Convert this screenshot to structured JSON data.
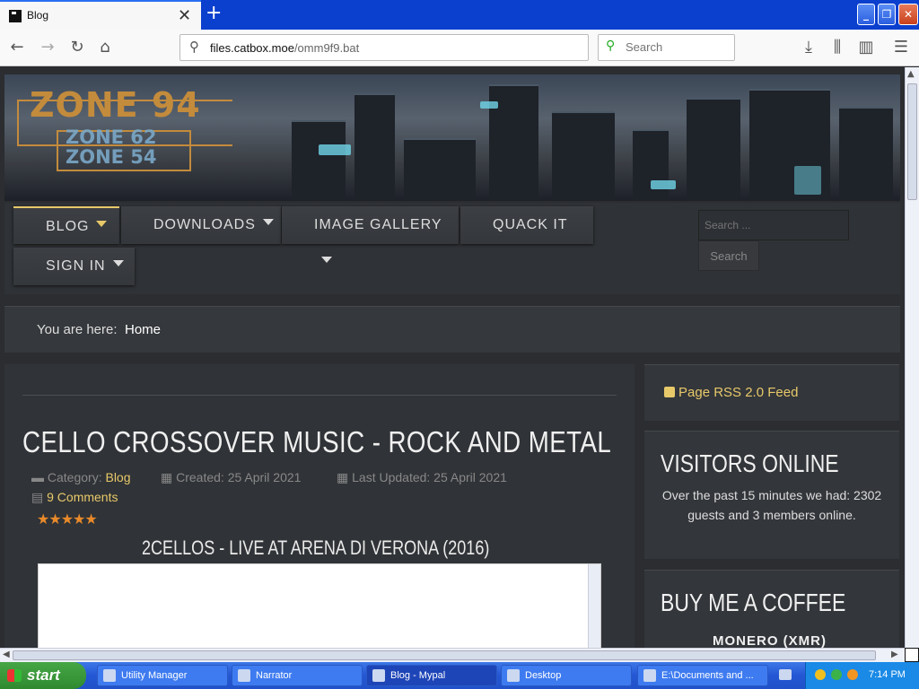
{
  "browser": {
    "tab_title": "Blog",
    "url_host": "files.catbox.moe",
    "url_path": "/omm9f9.bat",
    "search_placeholder": "Search"
  },
  "site": {
    "logo_main": "ZONE 94",
    "logo_sub1": "ZONE 62",
    "logo_sub2": "ZONE 54",
    "menu": [
      {
        "label": "BLOG"
      },
      {
        "label": "DOWNLOADS"
      },
      {
        "label": "IMAGE GALLERY"
      },
      {
        "label": "QUACK IT"
      },
      {
        "label": "SIGN IN"
      }
    ],
    "search_placeholder": "Search ...",
    "search_button": "Search",
    "breadcrumb_prefix": "You are here:",
    "breadcrumb_home": "Home"
  },
  "article": {
    "title": "CELLO CROSSOVER MUSIC - ROCK AND METAL",
    "category_label": "Category:",
    "category": "Blog",
    "created": "Created: 25 April 2021",
    "updated": "Last Updated: 25 April 2021",
    "comments": "9 Comments",
    "rating_stars": 5,
    "subtitle": "2CELLOS - LIVE AT ARENA DI VERONA (2016)"
  },
  "sidebar": {
    "rss": "Page RSS 2.0 Feed",
    "visitors_title": "VISITORS ONLINE",
    "visitors_text": "Over the past 15 minutes we had: 2302 guests and 3 members online.",
    "coffee_title": "BUY ME A COFFEE",
    "coffee_coin": "MONERO (XMR)"
  },
  "taskbar": {
    "start": "start",
    "tasks": [
      {
        "label": "Utility Manager"
      },
      {
        "label": "Narrator"
      },
      {
        "label": "Blog - Mypal"
      },
      {
        "label": "Desktop"
      },
      {
        "label": "E:\\Documents and ..."
      }
    ],
    "clock": "7:14 PM"
  }
}
